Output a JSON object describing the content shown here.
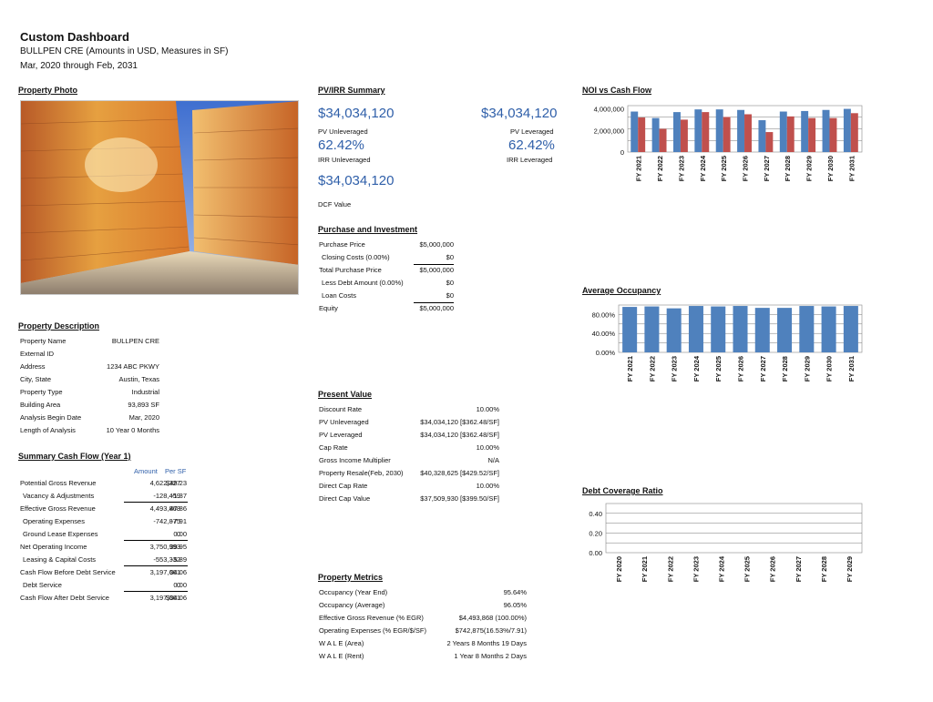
{
  "header": {
    "title": "Custom Dashboard",
    "subtitle": "BULLPEN CRE (Amounts in USD, Measures in SF)",
    "period": "Mar, 2020 through Feb, 2031"
  },
  "sections": {
    "photo": "Property Photo",
    "pvirr": "PV/IRR Summary",
    "noi": "NOI vs Cash Flow",
    "purchase": "Purchase and Investment",
    "occupancy": "Average Occupancy",
    "description": "Property Description",
    "present_value": "Present Value",
    "summary_cf": "Summary Cash Flow (Year 1)",
    "debt_coverage": "Debt Coverage Ratio",
    "metrics": "Property Metrics"
  },
  "pvirr": {
    "pv_unleveraged": "$34,034,120",
    "pv_unleveraged_label": "PV Unleveraged",
    "pv_leveraged": "$34,034,120",
    "pv_leveraged_label": "PV Leveraged",
    "irr_unleveraged": "62.42%",
    "irr_unleveraged_label": "IRR Unleveraged",
    "irr_leveraged": "62.42%",
    "irr_leveraged_label": "IRR Leveraged",
    "dcf_value": "$34,034,120",
    "dcf_label": "DCF Value"
  },
  "purchase": [
    {
      "label": "Purchase Price",
      "value": "$5,000,000",
      "indent": false
    },
    {
      "label": "Closing Costs (0.00%)",
      "value": "$0",
      "indent": true
    },
    {
      "label": "Total Purchase Price",
      "value": "$5,000,000",
      "indent": false
    },
    {
      "label": "Less Debt Amount (0.00%)",
      "value": "$0",
      "indent": true
    },
    {
      "label": "Loan Costs",
      "value": "$0",
      "indent": true
    },
    {
      "label": "Equity",
      "value": "$5,000,000",
      "indent": false
    }
  ],
  "description": [
    {
      "label": "Property Name",
      "value": "BULLPEN CRE"
    },
    {
      "label": "External ID",
      "value": ""
    },
    {
      "label": "Address",
      "value": "1234 ABC PKWY"
    },
    {
      "label": "City, State",
      "value": "Austin, Texas"
    },
    {
      "label": "Property Type",
      "value": "Industrial"
    },
    {
      "label": "Building Area",
      "value": "93,893 SF"
    },
    {
      "label": "Analysis Begin Date",
      "value": "Mar, 2020"
    },
    {
      "label": "Length of Analysis",
      "value": "10 Year 0 Months"
    }
  ],
  "summary_cf": {
    "col_amount": "Amount",
    "col_persf": "Per SF",
    "rows": [
      {
        "label": "Potential Gross Revenue",
        "amount": "4,622,327",
        "persf": "$49.23",
        "indent": false
      },
      {
        "label": "Vacancy & Adjustments",
        "amount": "-128,459",
        "persf": "-1.37",
        "indent": true
      },
      {
        "label": "Effective Gross Revenue",
        "amount": "4,493,868",
        "persf": "47.86",
        "indent": false
      },
      {
        "label": "Operating Expenses",
        "amount": "-742,875",
        "persf": "-7.91",
        "indent": true
      },
      {
        "label": "Ground Lease Expenses",
        "amount": "0",
        "persf": "0.00",
        "indent": true
      },
      {
        "label": "Net Operating Income",
        "amount": "3,750,993",
        "persf": "39.95",
        "indent": false
      },
      {
        "label": "Leasing & Capital Costs",
        "amount": "-553,332",
        "persf": "-5.89",
        "indent": true
      },
      {
        "label": "Cash Flow Before Debt Service",
        "amount": "3,197,661",
        "persf": "34.06",
        "indent": false
      },
      {
        "label": "Debt Service",
        "amount": "0",
        "persf": "0.00",
        "indent": true
      },
      {
        "label": "Cash Flow After Debt Service",
        "amount": "3,197,661",
        "persf": "$34.06",
        "indent": false
      }
    ]
  },
  "present_value": [
    {
      "label": "Discount Rate",
      "value": "10.00%"
    },
    {
      "label": "PV Unleveraged",
      "value": "$34,034,120 [$362.48/SF]"
    },
    {
      "label": "PV Leveraged",
      "value": "$34,034,120 [$362.48/SF]"
    },
    {
      "label": "Cap Rate",
      "value": "10.00%"
    },
    {
      "label": "Gross Income Multiplier",
      "value": "N/A"
    },
    {
      "label": "Property Resale(Feb, 2030)",
      "value": "$40,328,625 [$429.52/SF]"
    },
    {
      "label": "Direct Cap Rate",
      "value": "10.00%"
    },
    {
      "label": "Direct Cap Value",
      "value": "$37,509,930 [$399.50/SF]"
    }
  ],
  "metrics": [
    {
      "label": "Occupancy (Year End)",
      "value": "95.64%"
    },
    {
      "label": "Occupancy (Average)",
      "value": "96.05%"
    },
    {
      "label": "Effective Gross Revenue (% EGR)",
      "value": "$4,493,868 (100.00%)"
    },
    {
      "label": "Operating Expenses (% EGR/$/SF)",
      "value": "$742,875(16.53%/7.91)"
    },
    {
      "label": "W A L E (Area)",
      "value": "2 Years 8 Months 19 Days"
    },
    {
      "label": "W A L E (Rent)",
      "value": "1 Year 8 Months 2 Days"
    }
  ],
  "colors": {
    "blue": "#4f81bd",
    "red": "#c0504d",
    "accent_text": "#2f5fa9"
  },
  "chart_data": [
    {
      "type": "bar",
      "categories": [
        "FY 2021",
        "FY 2022",
        "FY 2023",
        "FY 2024",
        "FY 2025",
        "FY 2026",
        "FY 2027",
        "FY 2028",
        "FY 2029",
        "FY 2030",
        "FY 2031"
      ],
      "series": [
        {
          "values": [
            3750000,
            3150000,
            3700000,
            3950000,
            3950000,
            3900000,
            2950000,
            3750000,
            3800000,
            3900000,
            4000000
          ],
          "color": "#4f81bd"
        },
        {
          "values": [
            3200000,
            2150000,
            3000000,
            3700000,
            3250000,
            3500000,
            1850000,
            3300000,
            3150000,
            3150000,
            3600000
          ],
          "color": "#c0504d"
        }
      ],
      "yticks": [
        "0",
        "2,000,000",
        "4,000,000"
      ],
      "ylim": [
        0,
        4300000
      ]
    },
    {
      "type": "bar",
      "categories": [
        "FY 2021",
        "FY 2022",
        "FY 2023",
        "FY 2024",
        "FY 2025",
        "FY 2026",
        "FY 2027",
        "FY 2028",
        "FY 2029",
        "FY 2030",
        "FY 2031"
      ],
      "series": [
        {
          "values": [
            96,
            97,
            93,
            98,
            97,
            98,
            94,
            94,
            98,
            97,
            98
          ],
          "color": "#4f81bd"
        }
      ],
      "yticks": [
        "0.00%",
        "40.00%",
        "80.00%"
      ],
      "ylim": [
        0,
        100
      ]
    },
    {
      "type": "bar",
      "categories": [
        "FY 2020",
        "FY 2021",
        "FY 2022",
        "FY 2023",
        "FY 2024",
        "FY 2025",
        "FY 2026",
        "FY 2027",
        "FY 2028",
        "FY 2029"
      ],
      "series": [
        {
          "values": [
            0,
            0,
            0,
            0,
            0,
            0,
            0,
            0,
            0,
            0
          ],
          "color": "#4f81bd"
        }
      ],
      "yticks": [
        "0.00",
        "0.20",
        "0.40"
      ],
      "ylim": [
        0,
        0.5
      ]
    }
  ]
}
